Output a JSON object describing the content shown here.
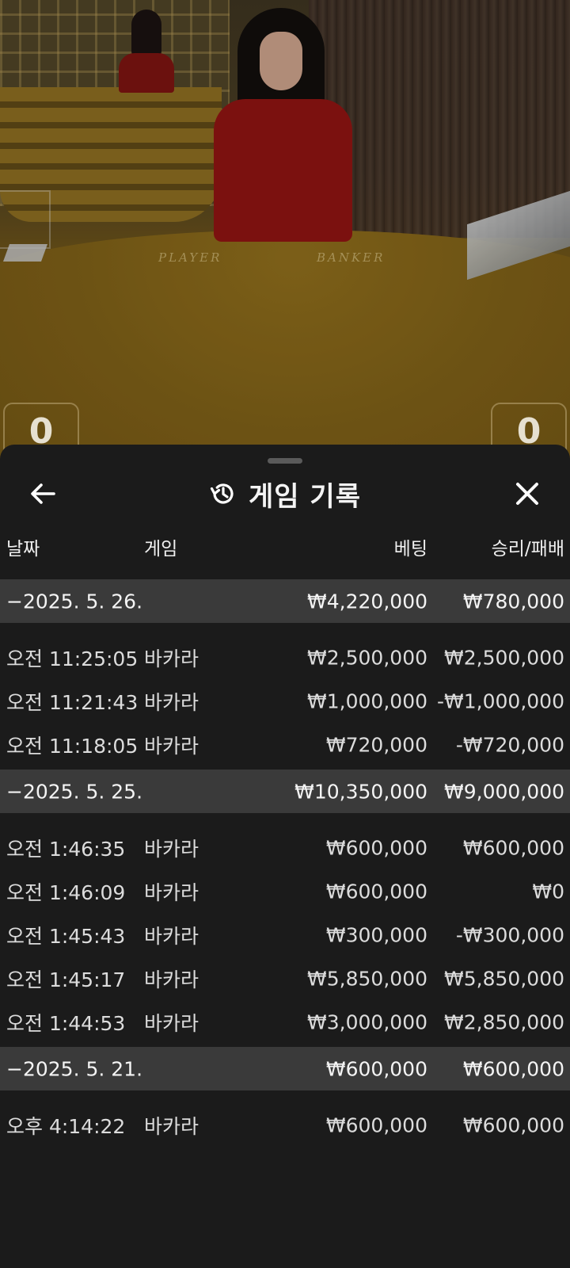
{
  "video": {
    "table_labels": {
      "player": "PLAYER",
      "banker": "BANKER"
    },
    "scores": {
      "player": "0",
      "banker": "0"
    }
  },
  "header": {
    "title": "게임 기록",
    "icons": {
      "back": "arrow-left-icon",
      "history": "history-icon",
      "close": "close-icon"
    }
  },
  "columns": {
    "date": "날짜",
    "game": "게임",
    "bet": "베팅",
    "win_loss": "승리/패배"
  },
  "groups": [
    {
      "date": "−2025. 5. 26.",
      "total_bet": "₩4,220,000",
      "total_win": "₩780,000",
      "entries": [
        {
          "time": "오전 11:25:05",
          "game": "바카라",
          "bet": "₩2,500,000",
          "win": "₩2,500,000"
        },
        {
          "time": "오전 11:21:43",
          "game": "바카라",
          "bet": "₩1,000,000",
          "win": "-₩1,000,000"
        },
        {
          "time": "오전 11:18:05",
          "game": "바카라",
          "bet": "₩720,000",
          "win": "-₩720,000"
        }
      ]
    },
    {
      "date": "−2025. 5. 25.",
      "total_bet": "₩10,350,000",
      "total_win": "₩9,000,000",
      "entries": [
        {
          "time": "오전 1:46:35",
          "game": "바카라",
          "bet": "₩600,000",
          "win": "₩600,000"
        },
        {
          "time": "오전 1:46:09",
          "game": "바카라",
          "bet": "₩600,000",
          "win": "₩0"
        },
        {
          "time": "오전 1:45:43",
          "game": "바카라",
          "bet": "₩300,000",
          "win": "-₩300,000"
        },
        {
          "time": "오전 1:45:17",
          "game": "바카라",
          "bet": "₩5,850,000",
          "win": "₩5,850,000"
        },
        {
          "time": "오전 1:44:53",
          "game": "바카라",
          "bet": "₩3,000,000",
          "win": "₩2,850,000"
        }
      ]
    },
    {
      "date": "−2025. 5. 21.",
      "total_bet": "₩600,000",
      "total_win": "₩600,000",
      "entries": [
        {
          "time": "오후 4:14:22",
          "game": "바카라",
          "bet": "₩600,000",
          "win": "₩600,000"
        }
      ]
    }
  ]
}
